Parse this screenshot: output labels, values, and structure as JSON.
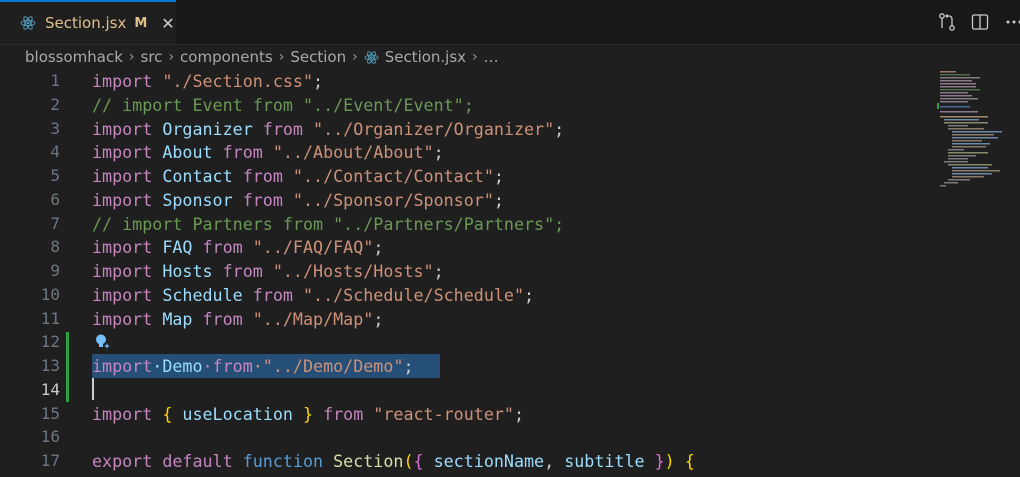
{
  "tab": {
    "label": "Section.jsx",
    "modified_badge": "M",
    "close_glyph": "✕"
  },
  "breadcrumb": [
    "blossomhack",
    "src",
    "components",
    "Section",
    "Section.jsx",
    "…"
  ],
  "line_numbers": [
    "1",
    "2",
    "3",
    "4",
    "5",
    "6",
    "7",
    "8",
    "9",
    "10",
    "11",
    "12",
    "13",
    "14",
    "15",
    "16",
    "17"
  ],
  "active_line": "14",
  "code": {
    "l1": [
      "import",
      " \"./Section.css\"",
      ";"
    ],
    "l2": "// import Event from \"../Event/Event\";",
    "l3": [
      "import",
      " Organizer",
      " from",
      " \"../Organizer/Organizer\"",
      ";"
    ],
    "l4": [
      "import",
      " About",
      " from",
      " \"../About/About\"",
      ";"
    ],
    "l5": [
      "import",
      " Contact",
      " from",
      " \"../Contact/Contact\"",
      ";"
    ],
    "l6": [
      "import",
      " Sponsor",
      " from",
      " \"../Sponsor/Sponsor\"",
      ";"
    ],
    "l7": "// import Partners from \"../Partners/Partners\";",
    "l8": [
      "import",
      " FAQ",
      " from",
      " \"../FAQ/FAQ\"",
      ";"
    ],
    "l9": [
      "import",
      " Hosts",
      " from",
      " \"../Hosts/Hosts\"",
      ";"
    ],
    "l10": [
      "import",
      " Schedule",
      " from",
      " \"../Schedule/Schedule\"",
      ";"
    ],
    "l11": [
      "import",
      " Map",
      " from",
      " \"../Map/Map\"",
      ";"
    ],
    "l13": [
      "import",
      "·Demo",
      "·from",
      "·\"../Demo/Demo\"",
      ";"
    ],
    "l15": [
      "import",
      " {",
      " useLocation",
      " }",
      " from",
      " \"react-router\"",
      ";"
    ],
    "l17": [
      "export",
      " default",
      " function",
      " Section",
      "(",
      "{",
      " sectionName",
      ",",
      " subtitle",
      " }",
      ")",
      " {"
    ]
  },
  "colors": {
    "accent": "#0078d4",
    "modified": "#e2c08d",
    "selection": "#264f78",
    "added_line": "#2ea043"
  },
  "icons": {
    "tab_file": "react-icon",
    "toolbar": [
      "open-changes-icon",
      "split-editor-icon",
      "more-actions-icon"
    ],
    "gutter": "lightbulb-sparkle-icon"
  }
}
